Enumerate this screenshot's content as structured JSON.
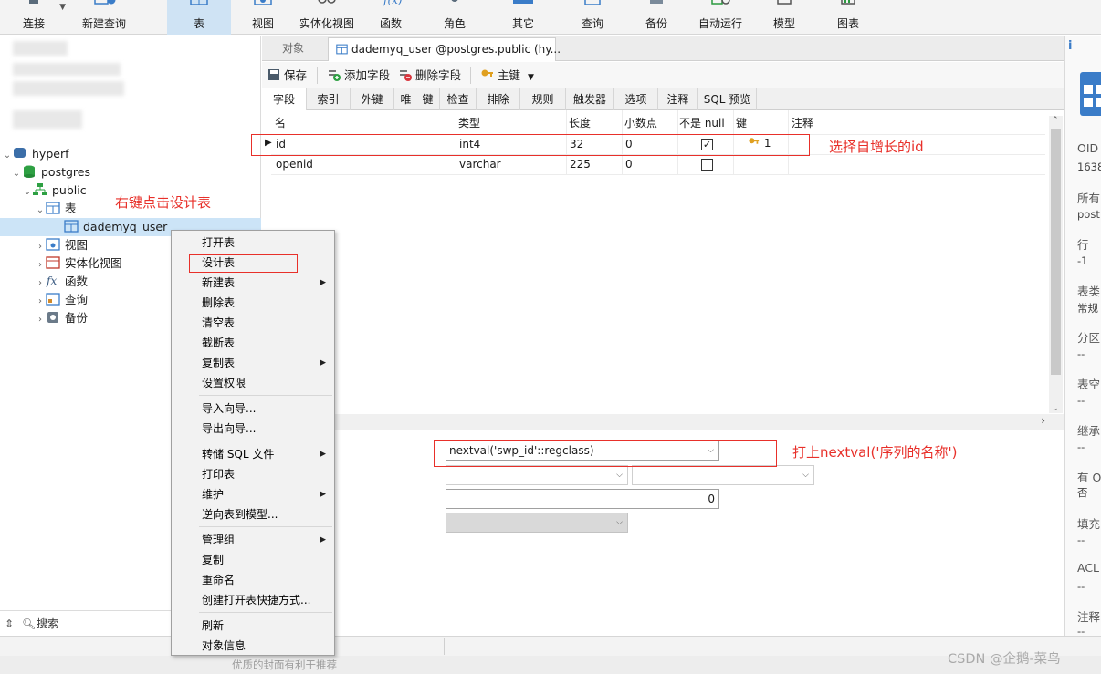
{
  "ribbon": {
    "buttons": [
      {
        "label": "连接",
        "icon": "connect-icon"
      },
      {
        "label": "新建查询",
        "icon": "new-query-icon"
      },
      {
        "label": "表",
        "icon": "table-icon",
        "active": true
      },
      {
        "label": "视图",
        "icon": "view-icon"
      },
      {
        "label": "实体化视图",
        "icon": "materialized-view-icon"
      },
      {
        "label": "函数",
        "icon": "function-icon"
      },
      {
        "label": "角色",
        "icon": "role-icon"
      },
      {
        "label": "其它",
        "icon": "other-icon"
      },
      {
        "label": "查询",
        "icon": "query-icon"
      },
      {
        "label": "备份",
        "icon": "backup-icon"
      },
      {
        "label": "自动运行",
        "icon": "auto-run-icon"
      },
      {
        "label": "模型",
        "icon": "model-icon"
      },
      {
        "label": "图表",
        "icon": "chart-icon"
      }
    ]
  },
  "nav": {
    "nodes": {
      "connection": "hyperf",
      "database": "postgres",
      "schema": "public",
      "tables": "表",
      "table_selected": "dademyq_user",
      "views": "视图",
      "mat_views": "实体化视图",
      "functions": "函数",
      "queries": "查询",
      "backups": "备份"
    },
    "search_label": "搜索"
  },
  "context_menu": {
    "items": [
      "打开表",
      "设计表",
      "新建表",
      "删除表",
      "清空表",
      "截断表",
      "复制表",
      "设置权限",
      "导入向导...",
      "导出向导...",
      "转储 SQL 文件",
      "打印表",
      "维护",
      "逆向表到模型...",
      "管理组",
      "复制",
      "重命名",
      "创建打开表快捷方式...",
      "刷新",
      "对象信息"
    ]
  },
  "editor": {
    "tabs": {
      "objects": "对象",
      "active": "dademyq_user @postgres.public (hy..."
    },
    "toolbar": {
      "save": "保存",
      "add_field": "添加字段",
      "delete_field": "删除字段",
      "primary_key": "主键"
    },
    "subtabs": [
      "字段",
      "索引",
      "外键",
      "唯一键",
      "检查",
      "排除",
      "规则",
      "触发器",
      "选项",
      "注释",
      "SQL 预览"
    ],
    "columns": {
      "name": "名",
      "type": "类型",
      "length": "长度",
      "decimals": "小数点",
      "not_null": "不是 null",
      "key": "键",
      "comment": "注释"
    },
    "rows": [
      {
        "name": "id",
        "type": "int4",
        "length": "32",
        "decimals": "0",
        "not_null": true,
        "key": "1"
      },
      {
        "name": "openid",
        "type": "varchar",
        "length": "225",
        "decimals": "0",
        "not_null": false,
        "key": ""
      }
    ],
    "props": {
      "default_value": "nextval('swp_id'::regclass)",
      "number_value": "0"
    }
  },
  "info_panel": {
    "labels": [
      "OID",
      "所有",
      "行",
      "表类",
      "分区",
      "表空",
      "继承",
      "有 O",
      "填充",
      "ACL",
      "注释"
    ],
    "values": [
      "1638",
      "post",
      "-1",
      "常规",
      "--",
      "--",
      "--",
      "否",
      "--",
      "--",
      "--"
    ],
    "info_icon": "i"
  },
  "annotations": {
    "right_click": "右键点击设计表",
    "select_id": "选择自增长的id",
    "nextval": "打上nextval('序列的名称')"
  },
  "footer": {
    "text": "优质的封面有利于推荐",
    "watermark": "CSDN @企鹅-菜鸟"
  },
  "colors": {
    "accent": "#cce4f7",
    "annotation": "#e8302a",
    "ribbon_active": "#cfe3f4"
  }
}
